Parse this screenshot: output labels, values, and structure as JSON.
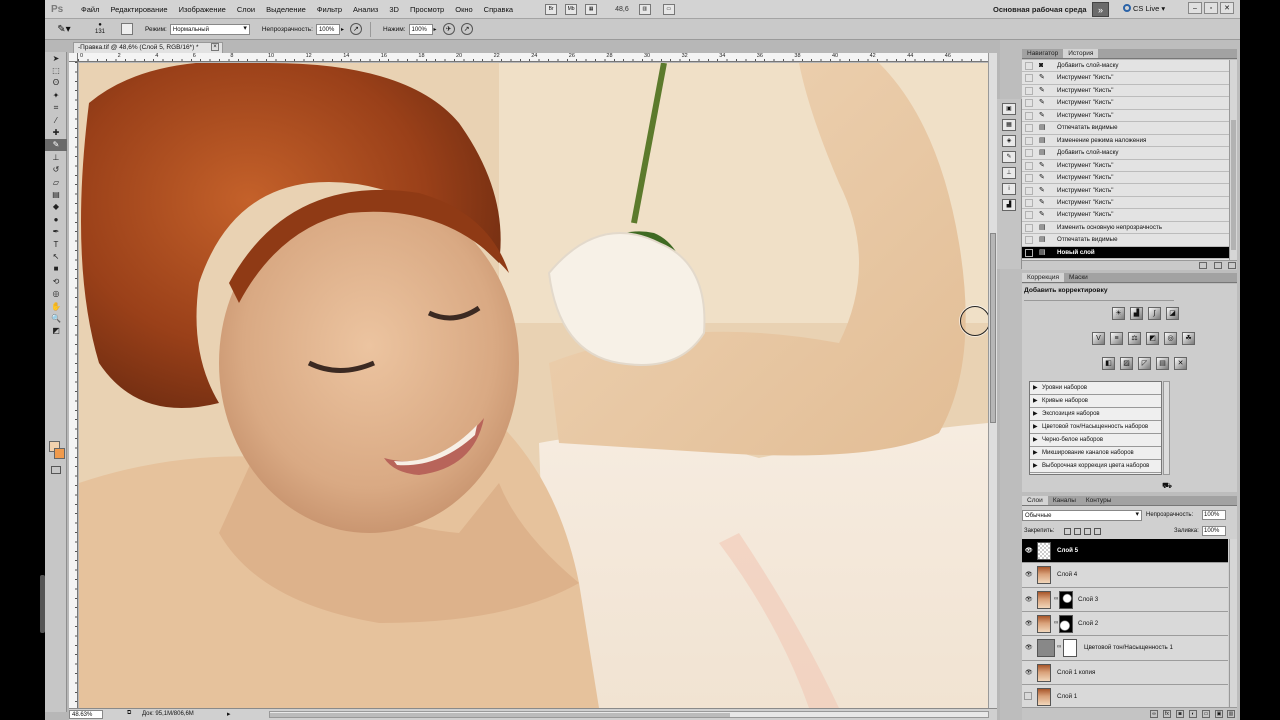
{
  "menubar": {
    "logo": "Ps",
    "items": [
      "Файл",
      "Редактирование",
      "Изображение",
      "Слои",
      "Выделение",
      "Фильтр",
      "Анализ",
      "3D",
      "Просмотр",
      "Окно",
      "Справка"
    ],
    "zoom": "48,6",
    "workspace": "Основная рабочая среда",
    "cslive": "CS Live"
  },
  "options": {
    "brush_size": "131",
    "mode_label": "Режим:",
    "mode_value": "Нормальный",
    "opacity_label": "Непрозрачность:",
    "opacity_value": "100%",
    "flow_label": "Нажим:",
    "flow_value": "100%"
  },
  "document": {
    "tab_title": "-Правка.tif @ 48,6% (Слой 5, RGB/16*) *",
    "ruler_labels": [
      "0",
      "2",
      "4",
      "6",
      "8",
      "10",
      "12",
      "14",
      "16",
      "18",
      "20",
      "22",
      "24",
      "26",
      "28",
      "30",
      "32",
      "34",
      "36",
      "38",
      "40",
      "42",
      "44",
      "46"
    ],
    "zoom": "48.63%",
    "doc_info": "Док: 95,1M/806,6M"
  },
  "history": {
    "tabs": [
      "Навигатор",
      "История"
    ],
    "active_tab": 1,
    "items": [
      {
        "label": "Добавить слой-маску",
        "icon": "layer-mask-icon"
      },
      {
        "label": "Инструмент \"Кисть\"",
        "icon": "brush-icon"
      },
      {
        "label": "Инструмент \"Кисть\"",
        "icon": "brush-icon"
      },
      {
        "label": "Инструмент \"Кисть\"",
        "icon": "brush-icon"
      },
      {
        "label": "Инструмент \"Кисть\"",
        "icon": "brush-icon"
      },
      {
        "label": "Отпечатать видимые",
        "icon": "document-icon"
      },
      {
        "label": "Изменение режима наложения",
        "icon": "document-icon"
      },
      {
        "label": "Добавить слой-маску",
        "icon": "document-icon"
      },
      {
        "label": "Инструмент \"Кисть\"",
        "icon": "brush-icon"
      },
      {
        "label": "Инструмент \"Кисть\"",
        "icon": "brush-icon"
      },
      {
        "label": "Инструмент \"Кисть\"",
        "icon": "brush-icon"
      },
      {
        "label": "Инструмент \"Кисть\"",
        "icon": "brush-icon"
      },
      {
        "label": "Инструмент \"Кисть\"",
        "icon": "brush-icon"
      },
      {
        "label": "Изменить основную непрозрачность",
        "icon": "document-icon"
      },
      {
        "label": "Отпечатать видимые",
        "icon": "document-icon"
      },
      {
        "label": "Новый слой",
        "icon": "document-icon"
      }
    ],
    "selected_index": 15
  },
  "adjustments": {
    "tabs": [
      "Коррекция",
      "Маски"
    ],
    "active_tab": 0,
    "title": "Добавить корректировку",
    "presets": [
      "Уровни наборов",
      "Кривые наборов",
      "Экспозиция наборов",
      "Цветовой тон/Насыщенность наборов",
      "Черно-белое наборов",
      "Микширование каналов наборов",
      "Выборочная коррекция цвета наборов"
    ]
  },
  "layers": {
    "tabs": [
      "Слои",
      "Каналы",
      "Контуры"
    ],
    "active_tab": 0,
    "blend_mode": "Обычные",
    "opacity_label": "Непрозрачность:",
    "opacity_value": "100%",
    "lock_label": "Закрепить:",
    "fill_label": "Заливка:",
    "fill_value": "100%",
    "items": [
      {
        "name": "Слой 5",
        "visible": true,
        "thumb": "transparent",
        "mask": null,
        "selected": true
      },
      {
        "name": "Слой 4",
        "visible": true,
        "thumb": "portrait",
        "mask": null,
        "selected": false
      },
      {
        "name": "Слой 3",
        "visible": true,
        "thumb": "portrait",
        "mask": "m1",
        "selected": false
      },
      {
        "name": "Слой 2",
        "visible": true,
        "thumb": "portrait",
        "mask": "m2",
        "selected": false
      },
      {
        "name": "Цветовой тон/Насыщенность 1",
        "visible": true,
        "thumb": "adj",
        "mask": "m3",
        "selected": false
      },
      {
        "name": "Слой 1 копия",
        "visible": true,
        "thumb": "portrait",
        "mask": null,
        "selected": false
      },
      {
        "name": "Слой 1",
        "visible": false,
        "thumb": "portrait",
        "mask": null,
        "selected": false
      }
    ]
  },
  "colors": {
    "foreground": "#f1d1ae",
    "background": "#f09a4c",
    "selection": "#000000"
  }
}
